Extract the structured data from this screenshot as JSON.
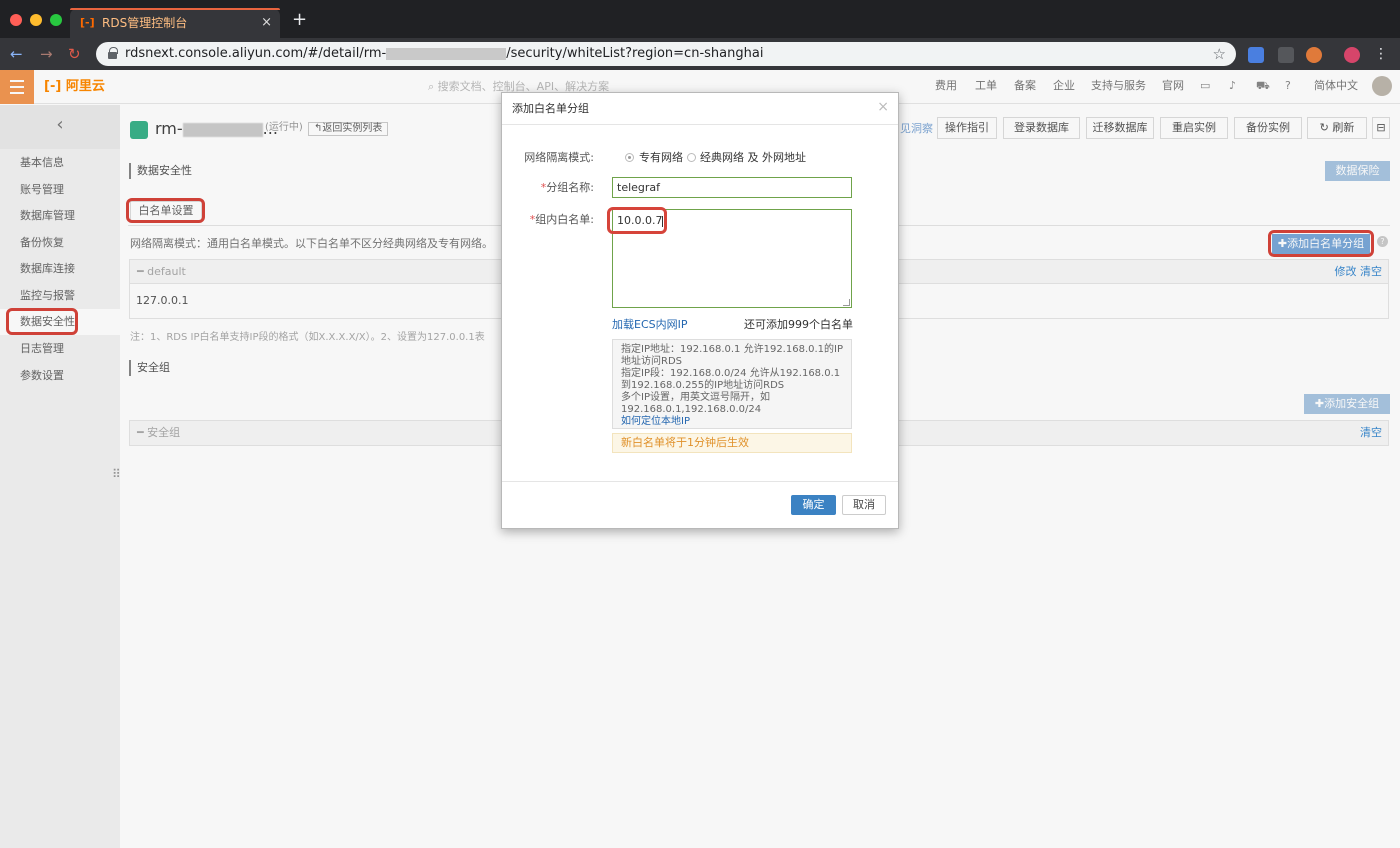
{
  "browser": {
    "tab_title": "RDS管理控制台",
    "tab_close": "×",
    "new_tab": "+",
    "url_prefix": "rdsnext.console.aliyun.com/#/detail/rm-",
    "url_suffix": "/security/whiteList?region=cn-shanghai",
    "icons": [
      "back-icon",
      "forward-icon",
      "reload-icon",
      "lock-icon",
      "star-icon",
      "translate-extension-icon",
      "extension-icon",
      "extension-icon",
      "profile-icon",
      "more-icon"
    ]
  },
  "header": {
    "logo": "阿里云",
    "search_placeholder": "搜索文档、控制台、API、解决方案",
    "items": [
      "费用",
      "工单",
      "备案",
      "企业",
      "支持与服务",
      "官网"
    ],
    "language": "简体中文"
  },
  "sidebar": {
    "back": "‹",
    "items": [
      "基本信息",
      "账号管理",
      "数据库管理",
      "备份恢复",
      "数据库连接",
      "监控与报警",
      "数据安全性",
      "日志管理",
      "参数设置"
    ],
    "active_index": 6
  },
  "instance": {
    "name_prefix": "rm-",
    "name_suffix": "...",
    "status": "(运行中)",
    "back_to_list": "↰返回实例列表",
    "buttons": {
      "insight": "见洞察",
      "guide": "操作指引",
      "login": "登录数据库",
      "migrate": "迁移数据库",
      "restart": "重启实例",
      "backup": "备份实例",
      "refresh": "刷新"
    }
  },
  "security": {
    "section_title": "数据安全性",
    "data_insurance": "数据保险",
    "tab_whitelist": "白名单设置",
    "mode_note": "网络隔离模式：通用白名单模式。以下白名单不区分经典网络及专有网络。",
    "add_group_btn": "✚添加白名单分组",
    "group_name": "default",
    "group_links": "修改 清空",
    "group_ip": "127.0.0.1",
    "foot_note": "注：1、RDS IP白名单支持IP段的格式（如X.X.X.X/X）。2、设置为127.0.0.1表",
    "sg_title": "安全组",
    "add_sg_btn": "✚添加安全组",
    "sg_group": "安全组",
    "sg_clear": "清空"
  },
  "modal": {
    "title": "添加白名单分组",
    "close": "×",
    "mode_label": "网络隔离模式:",
    "mode_option_1": "专有网络",
    "mode_option_2": "经典网络 及 外网地址",
    "group_name_label": "分组名称:",
    "group_name_value": "telegraf",
    "whitelist_label": "组内白名单:",
    "whitelist_value": "10.0.0.7",
    "load_ecs": "加载ECS内网IP",
    "remaining": "还可添加999个白名单",
    "help_lines": [
      "指定IP地址：192.168.0.1 允许192.168.0.1的IP",
      "地址访问RDS",
      "指定IP段：192.168.0.0/24 允许从192.168.0.1",
      "到192.168.0.255的IP地址访问RDS",
      "多个IP设置，用英文逗号隔开，如",
      "192.168.0.1,192.168.0.0/24"
    ],
    "help_link": "如何定位本地IP",
    "notice": "新白名单将于1分钟后生效",
    "ok": "确定",
    "cancel": "取消"
  },
  "colors": {
    "highlight": "#d6443a",
    "primary": "#3b82c3",
    "brand": "#ff8a00"
  }
}
